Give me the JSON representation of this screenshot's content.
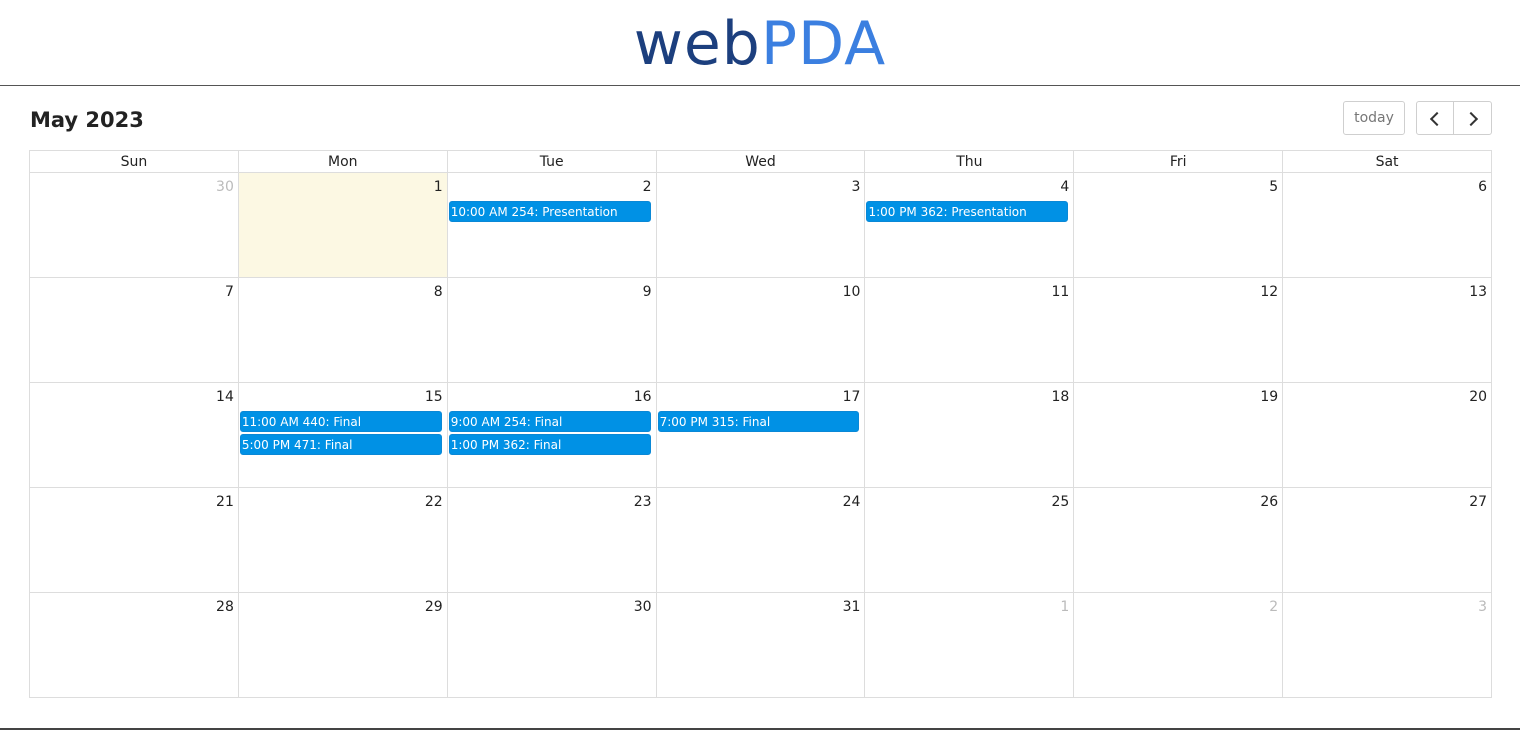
{
  "header": {
    "logo_part1": "web",
    "logo_part2": "PDA"
  },
  "toolbar": {
    "title": "May 2023",
    "today_label": "today",
    "prev_icon": "chevron-left-icon",
    "next_icon": "chevron-right-icon"
  },
  "colors": {
    "event": "#0091e5",
    "today_bg": "#fcf8e3",
    "logo_dark": "#1c3f7e",
    "logo_light": "#3b7fe0"
  },
  "days_of_week": [
    "Sun",
    "Mon",
    "Tue",
    "Wed",
    "Thu",
    "Fri",
    "Sat"
  ],
  "weeks": [
    {
      "days": [
        {
          "num": "30",
          "other": true,
          "events": []
        },
        {
          "num": "1",
          "today": true,
          "events": []
        },
        {
          "num": "2",
          "events": [
            "10:00 AM 254: Presentation"
          ]
        },
        {
          "num": "3",
          "events": []
        },
        {
          "num": "4",
          "events": [
            "1:00 PM 362: Presentation"
          ]
        },
        {
          "num": "5",
          "events": []
        },
        {
          "num": "6",
          "events": []
        }
      ]
    },
    {
      "days": [
        {
          "num": "7",
          "events": []
        },
        {
          "num": "8",
          "events": []
        },
        {
          "num": "9",
          "events": []
        },
        {
          "num": "10",
          "events": []
        },
        {
          "num": "11",
          "events": []
        },
        {
          "num": "12",
          "events": []
        },
        {
          "num": "13",
          "events": []
        }
      ]
    },
    {
      "days": [
        {
          "num": "14",
          "events": []
        },
        {
          "num": "15",
          "events": [
            "11:00 AM 440: Final",
            "5:00 PM 471: Final"
          ]
        },
        {
          "num": "16",
          "events": [
            "9:00 AM 254: Final",
            "1:00 PM 362: Final"
          ]
        },
        {
          "num": "17",
          "events": [
            "7:00 PM 315: Final"
          ]
        },
        {
          "num": "18",
          "events": []
        },
        {
          "num": "19",
          "events": []
        },
        {
          "num": "20",
          "events": []
        }
      ]
    },
    {
      "days": [
        {
          "num": "21",
          "events": []
        },
        {
          "num": "22",
          "events": []
        },
        {
          "num": "23",
          "events": []
        },
        {
          "num": "24",
          "events": []
        },
        {
          "num": "25",
          "events": []
        },
        {
          "num": "26",
          "events": []
        },
        {
          "num": "27",
          "events": []
        }
      ]
    },
    {
      "days": [
        {
          "num": "28",
          "events": []
        },
        {
          "num": "29",
          "events": []
        },
        {
          "num": "30",
          "events": []
        },
        {
          "num": "31",
          "events": []
        },
        {
          "num": "1",
          "other": true,
          "events": []
        },
        {
          "num": "2",
          "other": true,
          "events": []
        },
        {
          "num": "3",
          "other": true,
          "events": []
        }
      ]
    }
  ]
}
